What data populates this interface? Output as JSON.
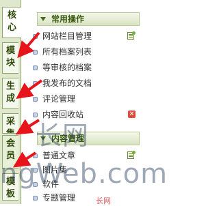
{
  "tabs": [
    {
      "label": "核心",
      "active": true
    },
    {
      "label": "模块"
    },
    {
      "label": "生成"
    },
    {
      "label": "采集"
    },
    {
      "label": "会员"
    },
    {
      "label": "模板"
    }
  ],
  "section1": {
    "title": "常用操作",
    "items": [
      {
        "label": "网站栏目管理",
        "icon": "add-icon"
      },
      {
        "label": "所有档案列表"
      },
      {
        "label": "等审核的档案"
      },
      {
        "label": "我发布的文档"
      },
      {
        "label": "评论管理"
      },
      {
        "label": "内容回收站",
        "icon": "delete-icon"
      }
    ]
  },
  "section2": {
    "title": "内容管理",
    "items": [
      {
        "label": "普通文章",
        "icon": "add-icon"
      },
      {
        "label": "图片集"
      },
      {
        "label": "软件"
      },
      {
        "label": "专题管理"
      }
    ]
  },
  "watermark": {
    "line1": "长网",
    "line2": "ngWeb.com",
    "red_text": "长网"
  },
  "colors": {
    "arrow": "#e8141b",
    "accent": "#3b5a12"
  }
}
